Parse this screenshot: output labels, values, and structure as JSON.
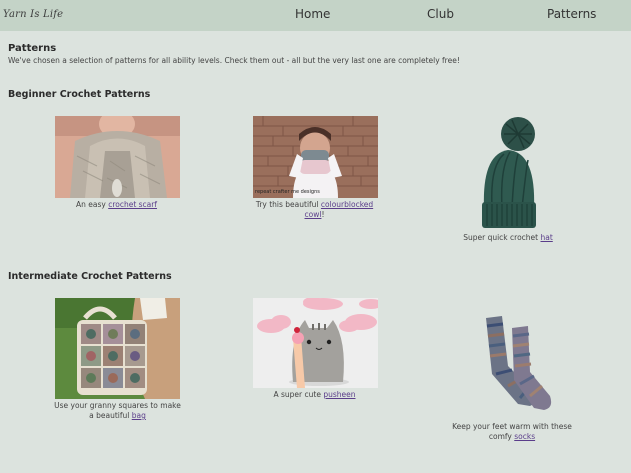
{
  "brand": {
    "name": "Yarn Is Life"
  },
  "nav": {
    "home": "Home",
    "club": "Club",
    "patterns": "Patterns"
  },
  "page": {
    "title": "Patterns",
    "intro": "We've chosen a selection of patterns for all ability levels. Check them out - all but the very last one are completely free!"
  },
  "sections": {
    "beginner": {
      "title": "Beginner Crochet Patterns",
      "items": [
        {
          "prefix": "An easy",
          "link": "crochet scarf",
          "suffix": ""
        },
        {
          "prefix": "Try this beautiful",
          "link": "colourblocked cowl",
          "suffix": "!",
          "watermark": "repeat crafter me designs"
        },
        {
          "prefix": "Super quick crochet",
          "link": "hat",
          "suffix": ""
        }
      ]
    },
    "intermediate": {
      "title": "Intermediate Crochet Patterns",
      "items": [
        {
          "prefix": "Use your granny squares to make a beautiful",
          "link": "bag",
          "suffix": ""
        },
        {
          "prefix": "A super cute",
          "link": "pusheen",
          "suffix": ""
        },
        {
          "prefix": "Keep your feet warm with these comfy",
          "link": "socks",
          "suffix": ""
        }
      ]
    }
  },
  "colors": {
    "topbar": "#c4d3c7",
    "background": "#dce3de",
    "link": "#5a3d8a"
  }
}
